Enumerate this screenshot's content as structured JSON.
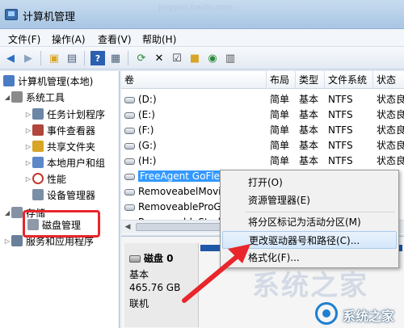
{
  "window": {
    "title": "计算机管理",
    "watermark_url": "jingyan.baidu.com"
  },
  "menu": [
    "文件(F)",
    "操作(A)",
    "查看(V)",
    "帮助(H)"
  ],
  "toolbar_icons": [
    "back-arrow",
    "forward-arrow",
    "folder-up",
    "console-tree",
    "help",
    "properties",
    "refresh",
    "delete",
    "properties-check",
    "open-folder",
    "search",
    "export"
  ],
  "tree": {
    "root": "计算机管理(本地)",
    "system_tools": "系统工具",
    "items": [
      "任务计划程序",
      "事件查看器",
      "共享文件夹",
      "本地用户和组",
      "性能",
      "设备管理器"
    ],
    "storage": "存储",
    "disk_management": "磁盘管理",
    "services": "服务和应用程序"
  },
  "list": {
    "columns": [
      "卷",
      "布局",
      "类型",
      "文件系统",
      "状态"
    ],
    "rows": [
      {
        "name": "(D:)",
        "layout": "简单",
        "type": "基本",
        "fs": "NTFS",
        "status": "状态良"
      },
      {
        "name": "(E:)",
        "layout": "简单",
        "type": "基本",
        "fs": "NTFS",
        "status": "状态良"
      },
      {
        "name": "(F:)",
        "layout": "简单",
        "type": "基本",
        "fs": "NTFS",
        "status": "状态良"
      },
      {
        "name": "(G:)",
        "layout": "简单",
        "type": "基本",
        "fs": "NTFS",
        "status": "状态良"
      },
      {
        "name": "(H:)",
        "layout": "简单",
        "type": "基本",
        "fs": "NTFS",
        "status": "状态良"
      },
      {
        "name": "FreeAgent GoFlex Drive (I:)",
        "layout": "",
        "type": "",
        "fs": "",
        "status": ""
      },
      {
        "name": "RemoveabelMovie",
        "layout": "",
        "type": "",
        "fs": "",
        "status": ""
      },
      {
        "name": "RemoveableProGr",
        "layout": "",
        "type": "",
        "fs": "",
        "status": ""
      },
      {
        "name": "RemoveableStudy",
        "layout": "",
        "type": "",
        "fs": "",
        "status": ""
      }
    ]
  },
  "disk": {
    "name": "磁盘 0",
    "type": "基本",
    "size": "465.76 GB",
    "status": "联机"
  },
  "context_menu": {
    "items": [
      "打开(O)",
      "资源管理器(E)",
      "将分区标记为活动分区(M)",
      "更改驱动器号和路径(C)...",
      "格式化(F)..."
    ],
    "highlighted": "更改驱动器号和路径(C)..."
  },
  "watermark": {
    "brand": "系统之家",
    "big": "系统之家"
  },
  "colors": {
    "annotation": "#e8262b",
    "selection": "#3399ff",
    "disk_strip": "#1f57a8"
  }
}
